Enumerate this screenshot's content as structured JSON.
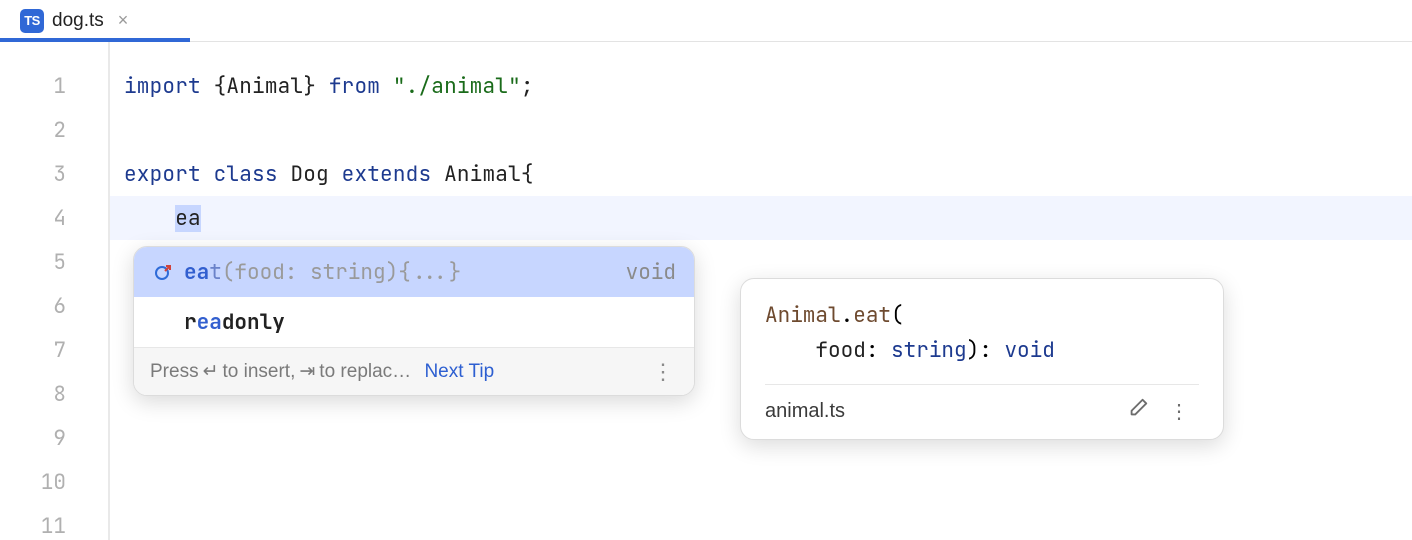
{
  "tab": {
    "badge": "TS",
    "filename": "dog.ts",
    "close": "×"
  },
  "gutter": {
    "lines": [
      "1",
      "2",
      "3",
      "4",
      "5",
      "6",
      "7",
      "8",
      "9",
      "10",
      "11"
    ]
  },
  "code": {
    "line1": {
      "kw1": "import",
      "open": " {",
      "ident": "Animal",
      "close": "} ",
      "kw2": "from",
      "sp": " ",
      "q1": "\"",
      "str": "./animal",
      "q2": "\"",
      "semi": ";"
    },
    "line3": {
      "kw1": "export",
      "sp1": " ",
      "kw2": "class",
      "sp2": " ",
      "name": "Dog",
      "sp3": " ",
      "kw3": "extends",
      "sp4": " ",
      "base": "Animal",
      "brace": "{"
    },
    "line4": {
      "indent": "    ",
      "typed": "ea"
    }
  },
  "autocomplete": {
    "items": [
      {
        "match": "ea",
        "boldTail": "t",
        "dimTail": "(food: string){...}",
        "type": "void"
      },
      {
        "plainPre": "r",
        "match": "ea",
        "boldTail": "donly",
        "dimTail": "",
        "type": ""
      }
    ],
    "footer": {
      "pressText": "Press ",
      "insertKey": "↵",
      "insertText": " to insert, ",
      "replaceKey": "⇥",
      "replaceText": " to replac…",
      "nextTip": "Next Tip",
      "more": "⋮"
    }
  },
  "quickdoc": {
    "className": "Animal",
    "dot": ".",
    "fn": "eat",
    "open": "(",
    "indent": "    ",
    "param": "food",
    "colon1": ": ",
    "ptype": "string",
    "close": ")",
    "colon2": ": ",
    "rtype": "void",
    "source": "animal.ts",
    "editIcon": "✎",
    "moreIcon": "⋮"
  }
}
